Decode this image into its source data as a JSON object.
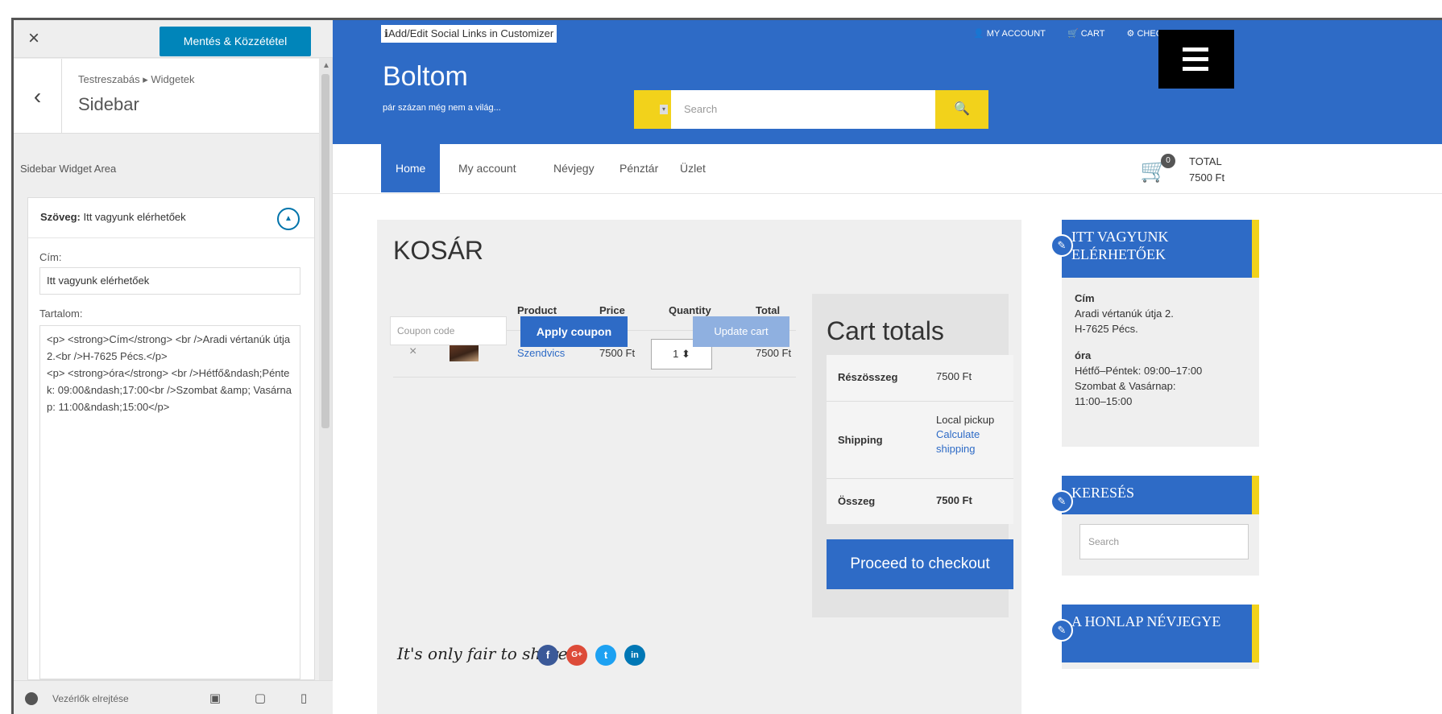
{
  "customizer": {
    "close_label": "×",
    "save_label": "Mentés & Közzététel",
    "breadcrumb": "Testreszabás ▸ Widgetek",
    "section_title": "Sidebar",
    "area_label": "Sidebar Widget Area",
    "widget_title_prefix": "Szöveg:",
    "widget_title": "Itt vagyunk elérhetőek",
    "field_title_label": "Cím:",
    "field_title_value": "Itt vagyunk elérhetőek",
    "field_content_label": "Tartalom:",
    "field_content_value": "<p> <strong>Cím</strong> <br />Aradi vértanúk útja 2.<br />H-7625 Pécs.</p>\n<p> <strong>óra</strong> <br />Hétfő&ndash;Péntek: 09:00&ndash;17:00<br />Szombat &amp; Vasárnap: 11:00&ndash;15:00</p>",
    "hide_controls_label": "Vezérlők elrejtése"
  },
  "site": {
    "social_links_label": "Add/Edit Social Links in Customizer",
    "topbar_links": [
      "MY ACCOUNT",
      "CART",
      "CHECKOUT"
    ],
    "logo": "Boltom",
    "tagline": "pár százan még nem a világ...",
    "search_placeholder": "Search",
    "nav": [
      "Home",
      "My account",
      "Névjegy",
      "Pénztár",
      "Üzlet"
    ],
    "cart_badge": "0",
    "cart_total_label": "TOTAL",
    "cart_total_value": "7500 Ft"
  },
  "cart": {
    "title": "KOSÁR",
    "headers": {
      "product": "Product",
      "price": "Price",
      "quantity": "Quantity",
      "total": "Total"
    },
    "row": {
      "remove": "×",
      "product": "Szendvics",
      "price": "7500 Ft",
      "quantity": "1",
      "total": "7500 Ft"
    },
    "coupon_placeholder": "Coupon code",
    "apply_coupon": "Apply coupon",
    "update_cart": "Update cart"
  },
  "totals": {
    "title": "Cart totals",
    "subtotal_label": "Részösszeg",
    "subtotal_value": "7500 Ft",
    "shipping_label": "Shipping",
    "shipping_method": "Local pickup",
    "shipping_link": "Calculate shipping",
    "total_label": "Összeg",
    "total_value": "7500 Ft",
    "checkout": "Proceed to checkout"
  },
  "share": {
    "label": "It's only fair to share...",
    "buttons": [
      "f",
      "G+",
      "t",
      "in"
    ]
  },
  "widgets": {
    "contact_title": "ITT VAGYUNK ELÉRHETŐEK",
    "contact_cim_label": "Cím",
    "contact_address1": "Aradi vértanúk útja 2.",
    "contact_address2": "H-7625 Pécs.",
    "contact_ora_label": "óra",
    "contact_hours1": "Hétfő–Péntek: 09:00–17:00",
    "contact_hours2": "Szombat & Vasárnap:",
    "contact_hours3": "11:00–15:00",
    "search_title": "KERESÉS",
    "search_placeholder": "Search",
    "about_title": "A HONLAP NÉVJEGYE"
  },
  "colors": {
    "primary": "#2e6bc6",
    "accent": "#f2d21b",
    "customizer_button": "#0085ba"
  }
}
